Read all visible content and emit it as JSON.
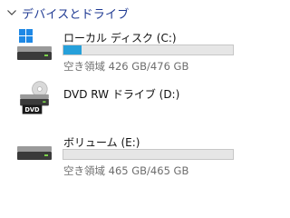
{
  "section": {
    "title": "デバイスとドライブ",
    "expanded": true,
    "chevron_icon": "chevron-down-icon"
  },
  "drives": [
    {
      "name": "ローカル ディスク (C:)",
      "icon": "windows-drive-icon",
      "free_text": "空き領域 426 GB/476 GB",
      "used_fraction": 0.105,
      "bar_color": "#26a0da"
    },
    {
      "name": "DVD RW ドライブ (D:)",
      "icon": "dvd-drive-icon",
      "icon_label": "DVD"
    },
    {
      "name": "ボリューム (E:)",
      "icon": "hard-drive-icon",
      "free_text": "空き領域 465 GB/465 GB",
      "used_fraction": 0.0,
      "bar_color": "#26a0da"
    }
  ]
}
